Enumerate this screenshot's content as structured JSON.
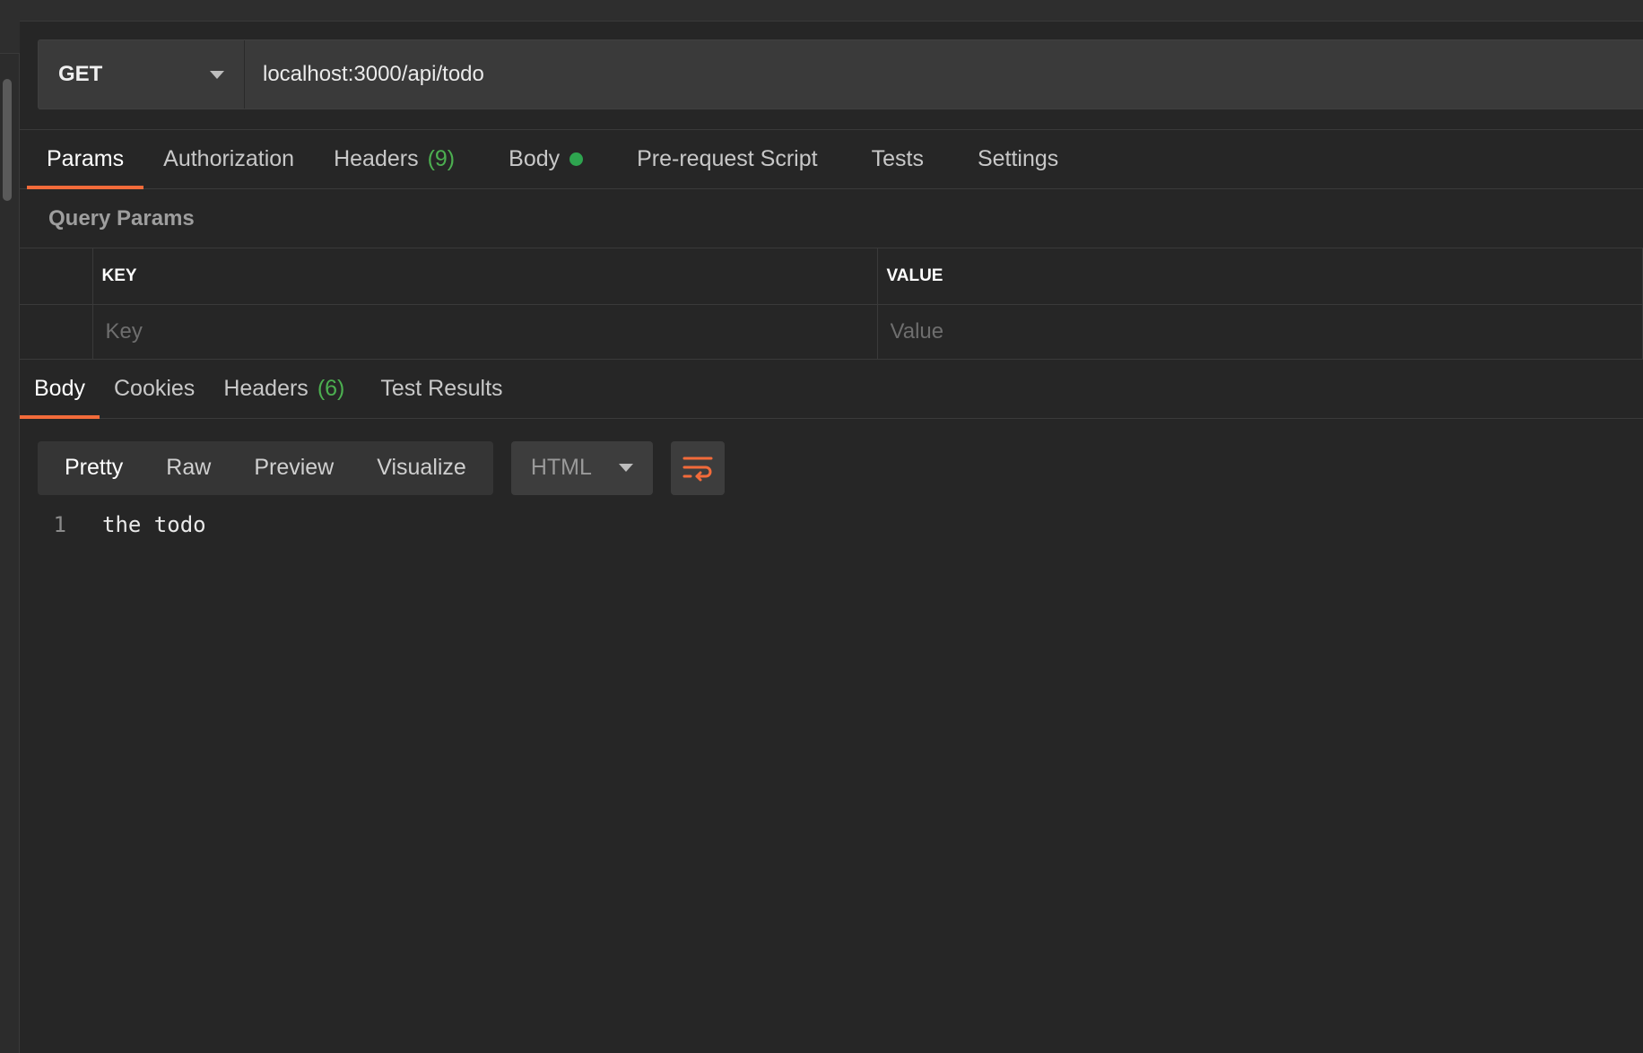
{
  "request": {
    "method": "GET",
    "url": "localhost:3000/api/todo"
  },
  "request_tabs": [
    {
      "label": "Params",
      "active": true
    },
    {
      "label": "Authorization"
    },
    {
      "label": "Headers",
      "count": "(9)"
    },
    {
      "label": "Body",
      "indicator": "green-dot"
    },
    {
      "label": "Pre-request Script"
    },
    {
      "label": "Tests"
    },
    {
      "label": "Settings"
    }
  ],
  "query_params": {
    "title": "Query Params",
    "columns": [
      "KEY",
      "VALUE"
    ],
    "key_placeholder": "Key",
    "value_placeholder": "Value"
  },
  "response_tabs": [
    {
      "label": "Body",
      "active": true
    },
    {
      "label": "Cookies"
    },
    {
      "label": "Headers",
      "count": "(6)"
    },
    {
      "label": "Test Results"
    }
  ],
  "view_modes": [
    {
      "label": "Pretty",
      "active": true
    },
    {
      "label": "Raw"
    },
    {
      "label": "Preview"
    },
    {
      "label": "Visualize"
    }
  ],
  "format": {
    "selected": "HTML"
  },
  "icons": {
    "method_caret": "chevron-down-icon",
    "format_caret": "chevron-down-icon",
    "wrap": "wrap-lines-icon",
    "body_indicator": "status-dot-icon"
  },
  "colors": {
    "accent": "#f26b3a",
    "count": "#4caf50",
    "dot": "#2ea44f",
    "background": "#262626"
  },
  "response_body": {
    "lines": [
      {
        "number": "1",
        "text": "the todo"
      }
    ]
  }
}
